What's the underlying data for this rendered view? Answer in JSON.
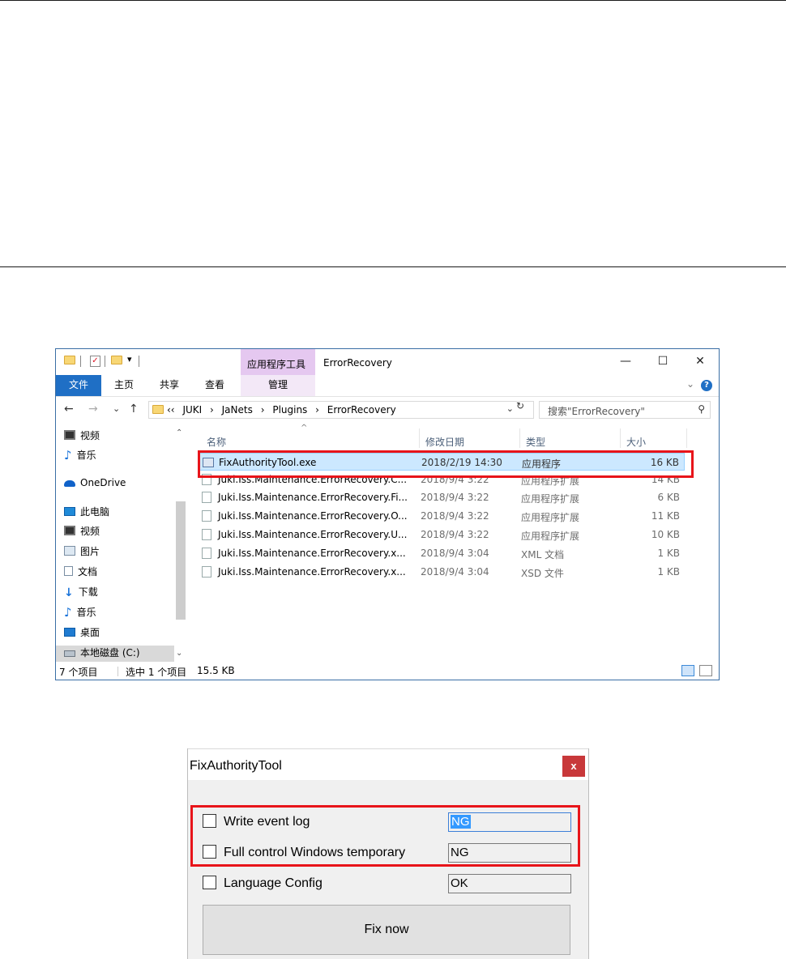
{
  "explorer": {
    "title": "ErrorRecovery",
    "context_tab": "应用程序工具",
    "ribbon_tabs": [
      "文件",
      "主页",
      "共享",
      "查看",
      "管理"
    ],
    "window_controls": {
      "minimize": "—",
      "maximize": "☐",
      "close": "✕"
    },
    "nav": {
      "back": "←",
      "forward": "→",
      "recent": "⌄",
      "up": "↑",
      "refresh": "↻"
    },
    "breadcrumbs": [
      "‹‹",
      "JUKI",
      "›",
      "JaNets",
      "›",
      "Plugins",
      "›",
      "ErrorRecovery"
    ],
    "search_placeholder": "搜索\"ErrorRecovery\"",
    "nav_pane": [
      {
        "label": "视频",
        "icon": "video-icon"
      },
      {
        "label": "音乐",
        "icon": "music-icon"
      },
      {
        "label": "OneDrive",
        "icon": "onedrive-icon"
      },
      {
        "label": "此电脑",
        "icon": "this-pc-icon"
      },
      {
        "label": "视频",
        "icon": "video-icon"
      },
      {
        "label": "图片",
        "icon": "pictures-icon"
      },
      {
        "label": "文档",
        "icon": "documents-icon"
      },
      {
        "label": "下载",
        "icon": "downloads-icon"
      },
      {
        "label": "音乐",
        "icon": "music-icon"
      },
      {
        "label": "桌面",
        "icon": "desktop-icon"
      },
      {
        "label": "本地磁盘 (C:)",
        "icon": "drive-icon"
      }
    ],
    "columns": [
      "名称",
      "修改日期",
      "类型",
      "大小"
    ],
    "files": [
      {
        "name": "FixAuthorityTool.exe",
        "date": "2018/2/19 14:30",
        "type": "应用程序",
        "size": "16 KB"
      },
      {
        "name": "Juki.Iss.Maintenance.ErrorRecovery.C...",
        "date": "2018/9/4 3:22",
        "type": "应用程序扩展",
        "size": "14 KB"
      },
      {
        "name": "Juki.Iss.Maintenance.ErrorRecovery.Fi...",
        "date": "2018/9/4 3:22",
        "type": "应用程序扩展",
        "size": "6 KB"
      },
      {
        "name": "Juki.Iss.Maintenance.ErrorRecovery.O...",
        "date": "2018/9/4 3:22",
        "type": "应用程序扩展",
        "size": "11 KB"
      },
      {
        "name": "Juki.Iss.Maintenance.ErrorRecovery.U...",
        "date": "2018/9/4 3:22",
        "type": "应用程序扩展",
        "size": "10 KB"
      },
      {
        "name": "Juki.Iss.Maintenance.ErrorRecovery.x...",
        "date": "2018/9/4 3:04",
        "type": "XML 文档",
        "size": "1 KB"
      },
      {
        "name": "Juki.Iss.Maintenance.ErrorRecovery.x...",
        "date": "2018/9/4 3:04",
        "type": "XSD 文件",
        "size": "1 KB"
      }
    ],
    "status": {
      "count": "7 个项目",
      "selected": "选中 1 个项目",
      "size": "15.5 KB"
    }
  },
  "dialog": {
    "title": "FixAuthorityTool",
    "close": "x",
    "options": [
      {
        "label": "Write event log",
        "value": "NG"
      },
      {
        "label": "Full control Windows temporary",
        "value": "NG"
      },
      {
        "label": "Language Config",
        "value": "OK"
      }
    ],
    "fix_button": "Fix now"
  },
  "colors": {
    "highlight_box": "#e8141a",
    "selection": "#cce8ff",
    "file_tab": "#1f6fc5",
    "context_tab": "#e5c8f0",
    "dialog_close": "#c8383a"
  }
}
